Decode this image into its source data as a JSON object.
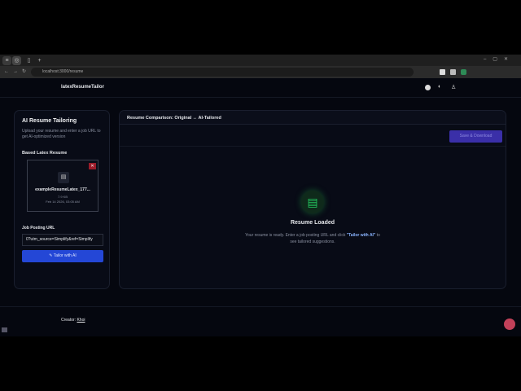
{
  "browser": {
    "url": "localhost:3000/resume",
    "new_tab": "+",
    "window_controls": [
      "–",
      "▢",
      "✕"
    ]
  },
  "header": {
    "brand": "latexResumeTailor"
  },
  "left": {
    "title": "AI Resume Tailoring",
    "subtitle": "Upload your resume and enter a job URL to get AI-optimized version",
    "section": "Based Latex Resume",
    "file_name": "exampleResumeLatex_177...",
    "file_size": "7.9 KB",
    "file_date": "Feb 14 2026, 03:05 AM",
    "remove": "✕",
    "url_label": "Job Posting URL",
    "url_value": "0?utm_source=Simplify&ref=Simplify",
    "tailor_button": "Tailor with AI"
  },
  "right": {
    "title": "Resume Comparison: Original ↔ AI-Tailored",
    "action_button": "Save & Download",
    "status_title": "Resume Loaded",
    "status_text_1": "Your resume is ready. Enter a job posting URL and click ",
    "status_highlight": "\"Tailor with AI\"",
    "status_text_2": " to see tailored suggestions."
  },
  "footer": {
    "label": "Creator:",
    "creator": "Khoi"
  },
  "colors": {
    "primary": "#2447d6",
    "accent": "#3a2fa8",
    "success": "#22c55e"
  }
}
